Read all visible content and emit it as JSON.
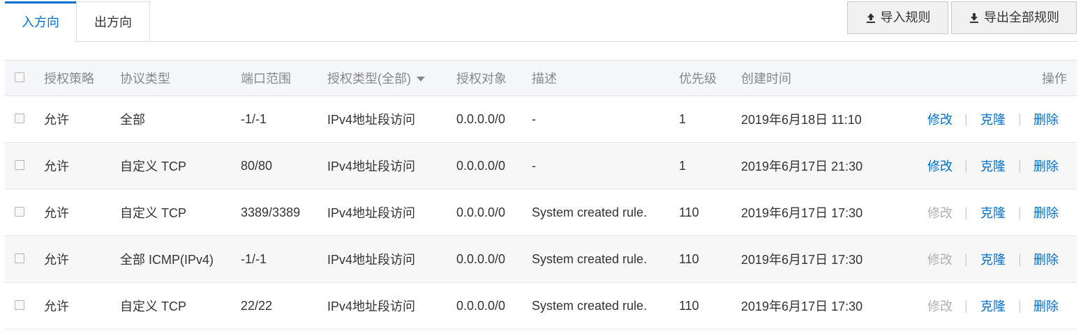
{
  "tabs": [
    {
      "label": "入方向",
      "active": true
    },
    {
      "label": "出方向",
      "active": false
    }
  ],
  "toolbar": {
    "import_label": "导入规则",
    "export_label": "导出全部规则"
  },
  "colors": {
    "accent": "#0070cc",
    "disabled": "#b0b0b0",
    "header_bg": "#f5f6fa"
  },
  "table": {
    "headers": {
      "policy": "授权策略",
      "protocol": "协议类型",
      "port": "端口范围",
      "auth_type": "授权类型(全部)",
      "target": "授权对象",
      "desc": "描述",
      "priority": "优先级",
      "created": "创建时间",
      "ops": "操作"
    },
    "op_labels": {
      "edit": "修改",
      "clone": "克隆",
      "delete": "删除",
      "sep": "|"
    },
    "rows": [
      {
        "policy": "允许",
        "protocol": "全部",
        "port": "-1/-1",
        "auth_type": "IPv4地址段访问",
        "target": "0.0.0.0/0",
        "desc": "-",
        "priority": "1",
        "created": "2019年6月18日 11:10",
        "edit_enabled": true
      },
      {
        "policy": "允许",
        "protocol": "自定义 TCP",
        "port": "80/80",
        "auth_type": "IPv4地址段访问",
        "target": "0.0.0.0/0",
        "desc": "-",
        "priority": "1",
        "created": "2019年6月17日 21:30",
        "edit_enabled": true
      },
      {
        "policy": "允许",
        "protocol": "自定义 TCP",
        "port": "3389/3389",
        "auth_type": "IPv4地址段访问",
        "target": "0.0.0.0/0",
        "desc": "System created rule.",
        "priority": "110",
        "created": "2019年6月17日 17:30",
        "edit_enabled": false
      },
      {
        "policy": "允许",
        "protocol": "全部 ICMP(IPv4)",
        "port": "-1/-1",
        "auth_type": "IPv4地址段访问",
        "target": "0.0.0.0/0",
        "desc": "System created rule.",
        "priority": "110",
        "created": "2019年6月17日 17:30",
        "edit_enabled": false
      },
      {
        "policy": "允许",
        "protocol": "自定义 TCP",
        "port": "22/22",
        "auth_type": "IPv4地址段访问",
        "target": "0.0.0.0/0",
        "desc": "System created rule.",
        "priority": "110",
        "created": "2019年6月17日 17:30",
        "edit_enabled": false
      }
    ]
  }
}
